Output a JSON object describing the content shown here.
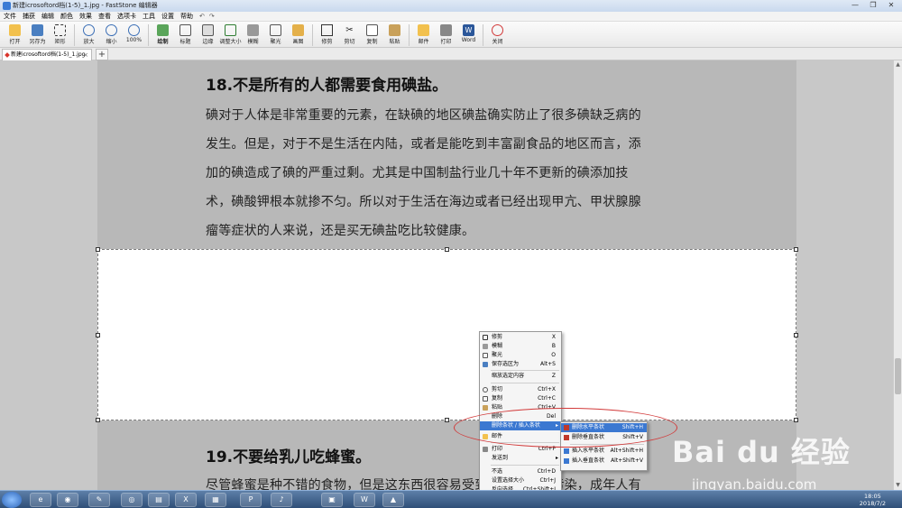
{
  "window": {
    "title": "新建icrosoftord档(1-5)_1.jpg - FastStone 编辑器",
    "controls": [
      "—",
      "❐",
      "✕"
    ]
  },
  "menubar": {
    "items": [
      "文件",
      "捕获",
      "编辑",
      "颜色",
      "效果",
      "查看",
      "选项卡",
      "工具",
      "设置",
      "帮助"
    ],
    "quick_actions": [
      "↶",
      "↷"
    ]
  },
  "toolbar": {
    "buttons": [
      {
        "label": "打开",
        "icon": "open-folder-icon"
      },
      {
        "label": "另存为",
        "icon": "save-as-icon"
      },
      {
        "label": "矩形",
        "icon": "rectangle-select-icon"
      },
      {
        "label": "放大",
        "icon": "zoom-in-icon"
      },
      {
        "label": "缩小",
        "icon": "zoom-out-icon"
      },
      {
        "label": "100%",
        "icon": "zoom-actual-icon"
      },
      {
        "label": "绘制",
        "icon": "draw-icon"
      },
      {
        "label": "标题",
        "icon": "caption-icon"
      },
      {
        "label": "边缘",
        "icon": "edge-icon"
      },
      {
        "label": "调整大小",
        "icon": "resize-icon"
      },
      {
        "label": "模糊",
        "icon": "blur-icon"
      },
      {
        "label": "聚光",
        "icon": "spotlight-icon"
      },
      {
        "label": "画图",
        "icon": "paint-icon"
      },
      {
        "label": "修剪",
        "icon": "crop-icon"
      },
      {
        "label": "剪切",
        "icon": "cut-icon"
      },
      {
        "label": "复制",
        "icon": "copy-icon"
      },
      {
        "label": "粘贴",
        "icon": "paste-icon"
      },
      {
        "label": "邮件",
        "icon": "mail-icon"
      },
      {
        "label": "打印",
        "icon": "print-icon"
      },
      {
        "label": "Word",
        "icon": "word-icon"
      },
      {
        "label": "关闭",
        "icon": "power-close-icon"
      }
    ]
  },
  "tabs": [
    {
      "label": "新建icrosoftord档(1-5)_1.jpg",
      "close": "×"
    }
  ],
  "tab_add": "+",
  "document": {
    "heading1": "18.不是所有的人都需要食用碘盐。",
    "paragraph1": [
      "碘对于人体是非常重要的元素，在缺碘的地区碘盐确实防止了很多碘缺乏病的",
      "发生。但是，对于不是生活在内陆，或者是能吃到丰富副食品的地区而言，添",
      "加的碘造成了碘的严重过剩。尤其是中国制盐行业几十年不更新的碘添加技",
      "术，碘酸钾根本就掺不匀。所以对于生活在海边或者已经出现甲亢、甲状腺腺",
      "瘤等症状的人来说，还是买无碘盐吃比较健康。"
    ],
    "heading2": "19.不要给乳儿吃蜂蜜。",
    "paragraph2": "尽管蜂蜜是种不错的食物，但是这东西很容易受到肉毒杆菌的污染，成年人有"
  },
  "context_menu": {
    "items": [
      {
        "label": "修剪",
        "shortcut": "X"
      },
      {
        "label": "模糊",
        "shortcut": "B"
      },
      {
        "label": "聚光",
        "shortcut": "O"
      },
      {
        "label": "保存选区为",
        "shortcut": "Alt+S"
      },
      {
        "label": "缩放选定内容",
        "shortcut": "Z"
      },
      {
        "label": "剪切",
        "shortcut": "Ctrl+X"
      },
      {
        "label": "复制",
        "shortcut": "Ctrl+C"
      },
      {
        "label": "粘贴",
        "shortcut": "Ctrl+V"
      },
      {
        "label": "删除",
        "shortcut": "Del"
      },
      {
        "label": "删除条状 / 插入条状",
        "shortcut": "▸"
      },
      {
        "label": "邮件",
        "shortcut": ""
      },
      {
        "label": "打印",
        "shortcut": "Ctrl+P"
      },
      {
        "label": "发送到",
        "shortcut": "▸"
      },
      {
        "label": "不选",
        "shortcut": "Ctrl+D"
      },
      {
        "label": "设置选择大小",
        "shortcut": "Ctrl+J"
      },
      {
        "label": "反向选择",
        "shortcut": "Ctrl+Shift+I"
      }
    ]
  },
  "submenu": {
    "items": [
      {
        "label": "删除水平条状",
        "shortcut": "Shift+H"
      },
      {
        "label": "删除垂直条状",
        "shortcut": "Shift+V"
      },
      {
        "label": "插入水平条状",
        "shortcut": "Alt+Shift+H"
      },
      {
        "label": "插入垂直条状",
        "shortcut": "Alt+Shift+V"
      }
    ]
  },
  "watermark": {
    "logo": "Bai du 经验",
    "url": "jingyan.baidu.com"
  },
  "taskbar": {
    "apps": [
      "e",
      "◉",
      "✎",
      "◎",
      "▤",
      "X",
      "▦",
      "P",
      "♪",
      "▣",
      "W",
      "▲"
    ],
    "clock_time": "18:05",
    "clock_date": "2018/7/2"
  },
  "colors": {
    "accent": "#3b78d1",
    "annotation": "#d23a3a"
  }
}
